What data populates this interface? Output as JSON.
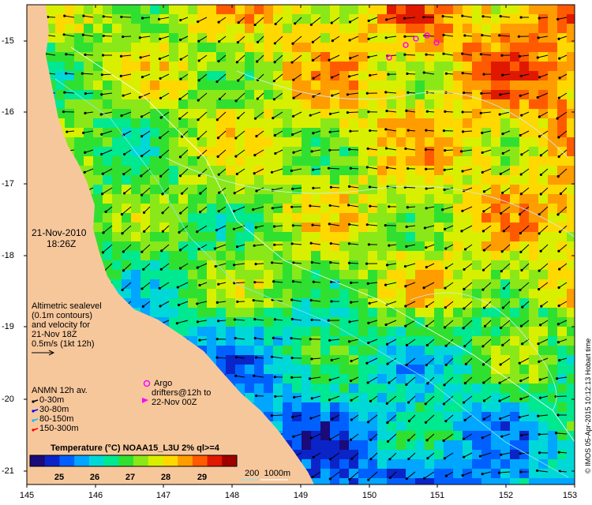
{
  "date": "21-Nov-2010",
  "time": "18:26Z",
  "altimetry_note": [
    "Altimetric sealevel",
    "(0.1m contours)",
    "and velocity for",
    "21-Nov 18Z",
    "0.5m/s (1kt 12h)"
  ],
  "anmn": {
    "title": "ANMN 12h av.",
    "items": [
      {
        "label": "0-30m",
        "color": "#000000"
      },
      {
        "label": "30-80m",
        "color": "#0000ff"
      },
      {
        "label": "80-150m",
        "color": "#00c0ff"
      },
      {
        "label": "150-300m",
        "color": "#ff0000"
      }
    ]
  },
  "argo_label": "Argo",
  "drifters_label": [
    "drifters@12h to",
    "22-Nov 00Z"
  ],
  "colorbar": {
    "title": "Temperature (°C) NOAA15_L3U 2% ql>=4",
    "ticks": [
      "25",
      "26",
      "27",
      "28",
      "29"
    ],
    "colors": [
      "#1a0a7a",
      "#0a24c8",
      "#0060ff",
      "#00a6ff",
      "#00d8d8",
      "#00e890",
      "#30e030",
      "#8ae818",
      "#d8f000",
      "#ffd800",
      "#ff9c00",
      "#ff5a00",
      "#e01800",
      "#a00000"
    ]
  },
  "depth_legend": "200  1000m",
  "side_label": "© IMOS 05-Apr-2015 10:12:13 Hobart time",
  "x_ticks": [
    "145",
    "146",
    "147",
    "148",
    "149",
    "150",
    "151",
    "152",
    "153"
  ],
  "y_ticks": [
    "-15",
    "-16",
    "-17",
    "-18",
    "-19",
    "-20",
    "-21"
  ],
  "colors": {
    "land": "#f7c79c",
    "frame": "#000000"
  }
}
